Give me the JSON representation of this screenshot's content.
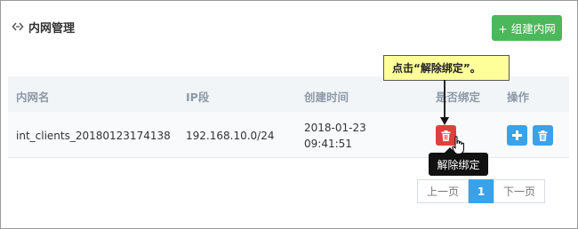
{
  "panel": {
    "title": "内网管理",
    "icon": "link-icon"
  },
  "toolbar": {
    "create_label": "+ 组建内网"
  },
  "table": {
    "columns": [
      "内网名",
      "IP段",
      "创建时间",
      "是否绑定",
      "操作"
    ],
    "rows": [
      {
        "name": "int_clients_20180123174138",
        "ip": "192.168.10.0/24",
        "date": "2018-01-23",
        "time": "09:41:51"
      }
    ]
  },
  "callout": {
    "text": "点击“解除绑定”。"
  },
  "tooltip": {
    "text": "解除绑定"
  },
  "pagination": {
    "prev": "上一页",
    "current": "1",
    "next": "下一页"
  },
  "colors": {
    "accent_green": "#4cb85c",
    "danger_red": "#e0403c",
    "primary_blue": "#3aa2e8",
    "callout_yellow": "#ffff99"
  }
}
